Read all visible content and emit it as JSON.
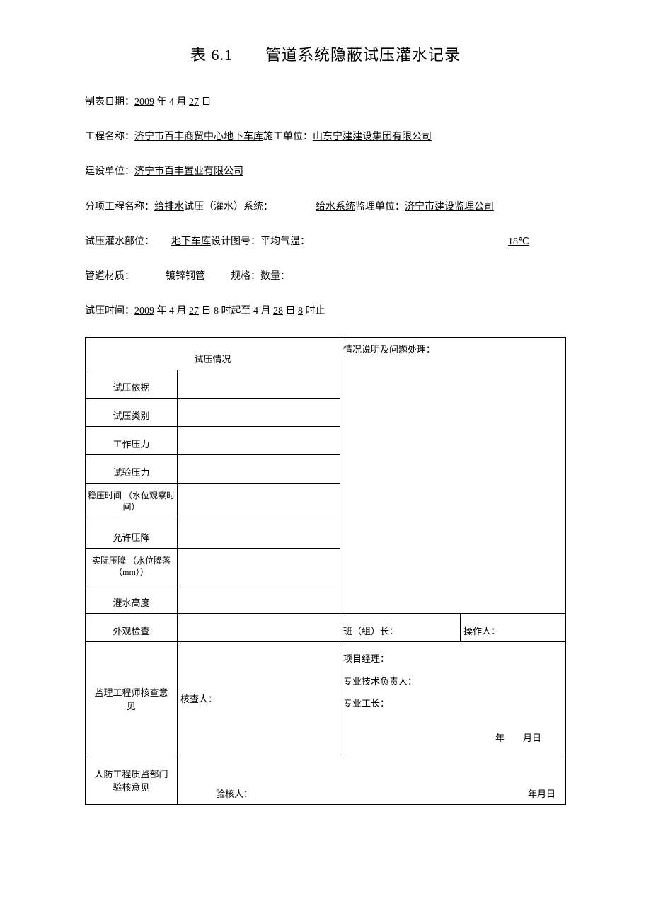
{
  "title": "表 6.1　　管道系统隐蔽试压灌水记录",
  "meta": {
    "date_label": "制表日期：",
    "date_year": "2009",
    "date_mid": " 年 4 月 ",
    "date_day": "27",
    "date_suffix": " 日",
    "proj_label": "工程名称：",
    "proj_name": "济宁市百丰商贸中心地下车库",
    "constr_label": "施工单位：",
    "constr_unit": "山东宁建建设集团有限公司",
    "build_label": "建设单位：",
    "build_unit": "济宁市百丰置业有限公司",
    "sub_label": "分项工程名称：",
    "sub_name": "给排水",
    "sub_suffix": "试压（灌水）系统：",
    "sys_name": "给水系统",
    "super_label": "监理单位：",
    "super_unit": "济宁市建设监理公司",
    "part_label": "试压灌水部位：",
    "part_name": "地下车库",
    "drawing_label": "设计图号：平均气温：",
    "temp": "18℃",
    "mat_label": "管道材质：",
    "mat_name": "镀锌钢管",
    "spec_label": "规格：数量：",
    "time_label": "试压时间：",
    "t_year": "2009",
    "t_mid1": " 年 4 月 ",
    "t_d1": "27",
    "t_mid2": " 日 8 时起至 4 月 ",
    "t_d2": "28",
    "t_mid3": " 日 ",
    "t_h2": "8",
    "t_end": " 时止"
  },
  "table": {
    "hdr_left": "试压情况",
    "hdr_right": "情况说明及问题处理：",
    "rows": [
      "试压依据",
      "试压类别",
      "工作压力",
      "试验压力",
      "稳压时间\n（水位观察时间）",
      "允许压降",
      "实际压降\n（水位降落（mm））",
      "灌水高度",
      "外观检查"
    ],
    "team_leader": "班（组）长：",
    "operator": "操作人：",
    "super_eng": "监理工程师核查意见",
    "checker": "核查人：",
    "pm": "项目经理：",
    "tech_lead": "专业技术负责人：",
    "foreman": "专业工长：",
    "date_ymr": "年　　月日",
    "defense": "人防工程质监部门验核意见",
    "verifier": "验核人：",
    "date_ymr2": "年月日"
  }
}
